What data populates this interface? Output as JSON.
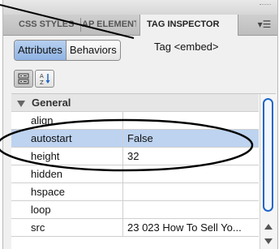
{
  "tabs": [
    {
      "label": "CSS STYLES"
    },
    {
      "label": "AP ELEMENTS"
    },
    {
      "label": "TAG INSPECTOR"
    }
  ],
  "segmented": {
    "attributes": "Attributes",
    "behaviors": "Behaviors"
  },
  "tag_label": "Tag <embed>",
  "view_buttons": [
    "category-view-icon",
    "alphabetical-view-icon"
  ],
  "category": "General",
  "rows": [
    {
      "name": "align",
      "value": ""
    },
    {
      "name": "autostart",
      "value": "False"
    },
    {
      "name": "height",
      "value": "32"
    },
    {
      "name": "hidden",
      "value": ""
    },
    {
      "name": "hspace",
      "value": ""
    },
    {
      "name": "loop",
      "value": ""
    },
    {
      "name": "src",
      "value": "23 023 How To Sell Yo..."
    }
  ],
  "colors": {
    "selected_row": "#bdd3f0",
    "active_button": "#8fb3e4",
    "scroll_thumb": "#1e66c8"
  }
}
